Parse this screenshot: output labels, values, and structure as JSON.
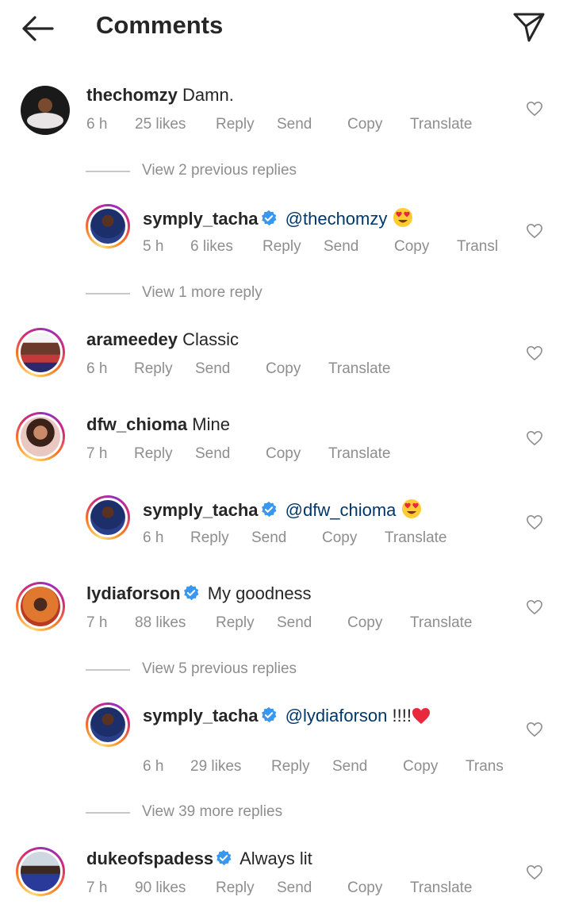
{
  "header": {
    "title": "Comments",
    "back_icon": "arrow-left-icon",
    "send_icon": "paper-plane-icon"
  },
  "actions": {
    "reply": "Reply",
    "send": "Send",
    "copy": "Copy",
    "translate": "Translate"
  },
  "comments": [
    {
      "username": "thechomzy",
      "text": "Damn.",
      "time": "6 h",
      "likes": "25 likes",
      "verified": false
    },
    {
      "view_replies": "View 2 previous replies"
    },
    {
      "username": "symply_tacha",
      "mention": "@thechomzy",
      "emoji": "heart-eyes",
      "time": "5 h",
      "likes": "6 likes",
      "translate": "Transl",
      "verified": true
    },
    {
      "view_replies": "View 1 more reply"
    },
    {
      "username": "arameedey",
      "text": "Classic",
      "time": "6 h",
      "verified": false
    },
    {
      "username": "dfw_chioma",
      "text": "Mine",
      "time": "7 h",
      "verified": false
    },
    {
      "username": "symply_tacha",
      "mention": "@dfw_chioma",
      "emoji": "heart-eyes",
      "time": "6 h",
      "verified": true
    },
    {
      "username": "lydiaforson",
      "text": "My goodness",
      "time": "7 h",
      "likes": "88 likes",
      "verified": true
    },
    {
      "view_replies": "View 5 previous replies"
    },
    {
      "username": "symply_tacha",
      "mention": "@lydiaforson",
      "text": "!!!!",
      "emoji": "red-heart",
      "time": "6 h",
      "likes": "29 likes",
      "translate": "Trans",
      "verified": true
    },
    {
      "view_replies": "View 39 more replies"
    },
    {
      "username": "dukeofspadess",
      "text": "Always lit",
      "time": "7 h",
      "likes": "90 likes",
      "verified": true
    }
  ],
  "colors": {
    "text": "#262626",
    "secondary": "#8e8e8e",
    "mention": "#00376b",
    "verified": "#3897f0"
  }
}
